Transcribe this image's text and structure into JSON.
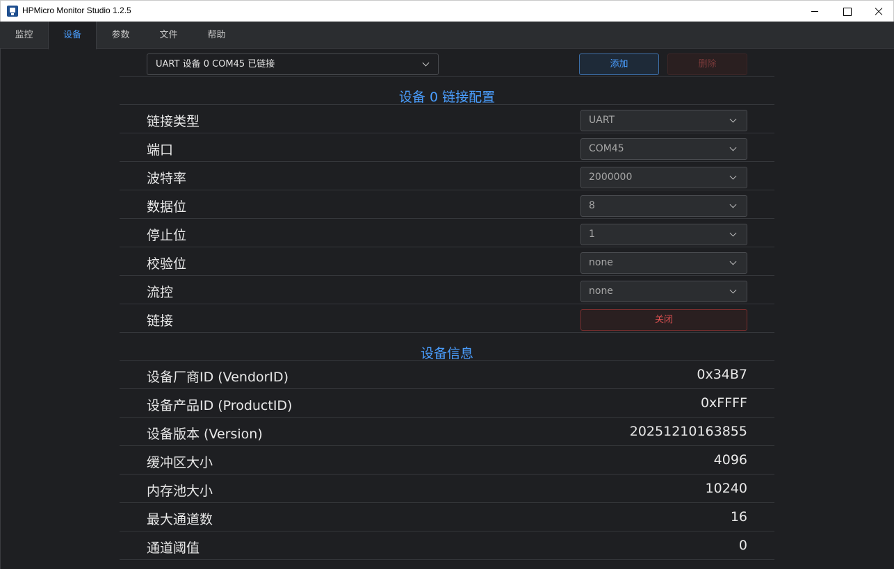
{
  "window": {
    "title": "HPMicro Monitor Studio 1.2.5"
  },
  "tabs": [
    {
      "label": "监控"
    },
    {
      "label": "设备"
    },
    {
      "label": "参数"
    },
    {
      "label": "文件"
    },
    {
      "label": "帮助"
    }
  ],
  "active_tab": "设备",
  "device": {
    "selected": "UART 设备 0 COM45 已链接",
    "add_label": "添加",
    "delete_label": "删除"
  },
  "link_config": {
    "title": "设备 0 链接配置",
    "rows": [
      {
        "label": "链接类型",
        "value": "UART"
      },
      {
        "label": "端口",
        "value": "COM45"
      },
      {
        "label": "波特率",
        "value": "2000000"
      },
      {
        "label": "数据位",
        "value": "8"
      },
      {
        "label": "停止位",
        "value": "1"
      },
      {
        "label": "校验位",
        "value": "none"
      },
      {
        "label": "流控",
        "value": "none"
      }
    ],
    "link_label": "链接",
    "link_button": "关闭"
  },
  "device_info": {
    "title": "设备信息",
    "rows": [
      {
        "label": "设备厂商ID (VendorID)",
        "value": "0x34B7"
      },
      {
        "label": "设备产品ID (ProductID)",
        "value": "0xFFFF"
      },
      {
        "label": "设备版本 (Version)",
        "value": "20251210163855"
      },
      {
        "label": "缓冲区大小",
        "value": "4096"
      },
      {
        "label": "内存池大小",
        "value": "10240"
      },
      {
        "label": "最大通道数",
        "value": "16"
      },
      {
        "label": "通道阈值",
        "value": "0"
      }
    ]
  },
  "colors": {
    "accent": "#4a9eff",
    "danger": "#e05252",
    "background": "#1e1f22",
    "panel": "#2b2d30"
  }
}
